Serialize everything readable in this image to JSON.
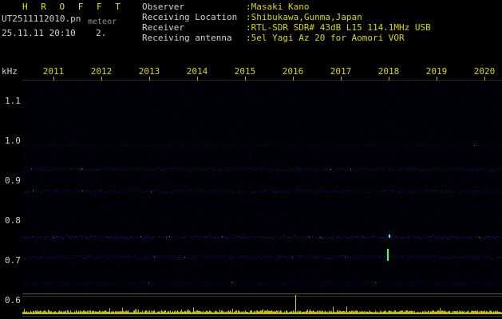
{
  "header": {
    "app_title": "H R O F F T",
    "filename": "UT2511112010.pn",
    "filename_sub": "meteor",
    "datetime": "25.11.11 20:10",
    "counter": "2."
  },
  "meta": {
    "rows": [
      {
        "label": "Observer",
        "value": ":Masaki Kano"
      },
      {
        "label": "Receiving Location",
        "value": ":Shibukawa,Gunma,Japan"
      },
      {
        "label": "Receiver",
        "value": ":RTL-SDR SDR# 43dB L15 114.1MHz USB"
      },
      {
        "label": "Receiving antenna",
        "value": ":5el Yagi Az 20 for Aomori VOR"
      }
    ]
  },
  "axis": {
    "freq_unit": "kHz",
    "freq_ticks": [
      "1.1",
      "1.0",
      "0.9",
      "0.8",
      "0.7",
      "0.6"
    ],
    "time_ticks": [
      "2011",
      "2012",
      "2013",
      "2014",
      "2015",
      "2016",
      "2017",
      "2018",
      "2019",
      "2020"
    ]
  },
  "colors": {
    "accent_yellow": "#d8d800",
    "tick_yellow": "#b8b800",
    "text_white": "#d0d0d0",
    "noise_blue": "#3232e6",
    "echo_green": "#44ff66",
    "echo_cyan": "#55e6ff"
  },
  "chart_data": {
    "type": "heatmap",
    "title": "HROFFT 10-minute radio meteor spectrogram",
    "x": {
      "ticks": [
        "2011",
        "2012",
        "2013",
        "2014",
        "2015",
        "2016",
        "2017",
        "2018",
        "2019",
        "2020"
      ]
    },
    "y": {
      "unit": "kHz",
      "ticks": [
        1.1,
        1.0,
        0.9,
        0.8,
        0.7,
        0.6
      ],
      "top": 1.16,
      "bottom": 0.62
    },
    "noise_bands": [
      {
        "khz": 0.99,
        "intensity": 0.25
      },
      {
        "khz": 0.93,
        "intensity": 0.5
      },
      {
        "khz": 0.875,
        "intensity": 0.45
      },
      {
        "khz": 0.76,
        "intensity": 0.7
      },
      {
        "khz": 0.71,
        "intensity": 0.5
      },
      {
        "khz": 0.645,
        "intensity": 0.28
      }
    ],
    "echoes": [
      {
        "time_frac": 0.76,
        "khz_from": 0.7,
        "khz_to": 0.73,
        "color": "#44ff66"
      },
      {
        "time_frac": 0.763,
        "khz_from": 0.758,
        "khz_to": 0.766,
        "color": "#55e6ff"
      }
    ],
    "level_strip": {
      "spikes": [
        {
          "time_frac": 0.569,
          "height_frac": 1.0
        }
      ]
    }
  }
}
